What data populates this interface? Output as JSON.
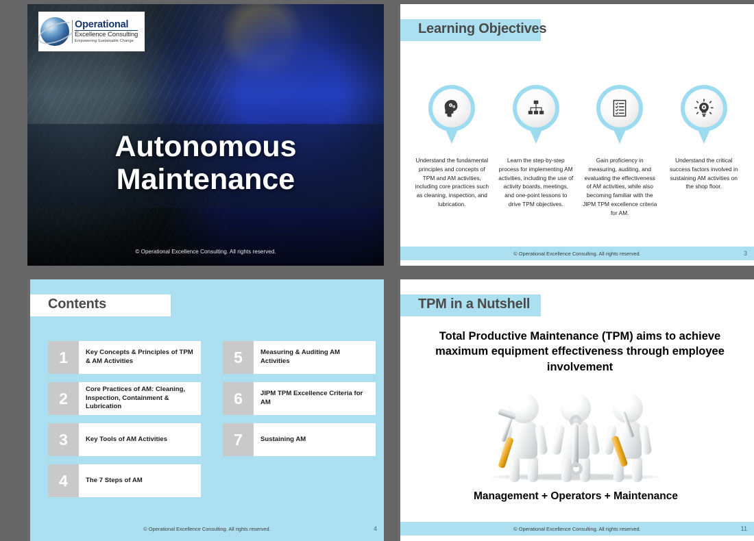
{
  "theme": {
    "accent_blue": "#ACE0F0",
    "pin_blue": "#9ddcf0",
    "gray_bg": "#666666",
    "num_box_gray": "#c9c9c9",
    "title_gray": "#4a4a4a"
  },
  "slide_title": {
    "logo": {
      "line1": "Operational",
      "line2": "Excellence Consulting",
      "line3": "Empowering Sustainable Change"
    },
    "title_line1": "Autonomous",
    "title_line2": "Maintenance",
    "copyright": "© Operational Excellence Consulting.  All rights reserved."
  },
  "slide_objectives": {
    "heading": "Learning Objectives",
    "items": [
      {
        "icon": "head-gears-icon",
        "text": "Understand the fundamental principles and concepts of TPM and AM activities, including core practices such as cleaning, inspection, and lubrication."
      },
      {
        "icon": "org-chart-icon",
        "text": "Learn the step-by-step process for implementing AM activities, including the use of activity boards, meetings, and one-point lessons to drive TPM objectives."
      },
      {
        "icon": "checklist-icon",
        "text": "Gain proficiency in measuring, auditing, and evaluating the effectiveness of AM activities, while also becoming familiar with the JIPM TPM excellence criteria for AM."
      },
      {
        "icon": "lightbulb-gear-icon",
        "text": "Understand the critical success factors involved in sustaining AM activities on the shop floor."
      }
    ],
    "footer": "© Operational Excellence Consulting.  All rights reserved.",
    "page": "3"
  },
  "slide_contents": {
    "heading": "Contents",
    "items_left": [
      {
        "num": "1",
        "label": "Key Concepts & Principles of TPM & AM Activities"
      },
      {
        "num": "2",
        "label": "Core Practices of AM: Cleaning, Inspection, Containment & Lubrication"
      },
      {
        "num": "3",
        "label": "Key Tools of AM Activities"
      },
      {
        "num": "4",
        "label": "The 7 Steps of AM"
      }
    ],
    "items_right": [
      {
        "num": "5",
        "label": "Measuring & Auditing AM Activities"
      },
      {
        "num": "6",
        "label": "JIPM TPM Excellence Criteria for AM"
      },
      {
        "num": "7",
        "label": "Sustaining AM"
      }
    ],
    "footer": "© Operational Excellence Consulting.  All rights reserved.",
    "page": "4"
  },
  "slide_nutshell": {
    "heading": "TPM in a Nutshell",
    "statement": "Total Productive Maintenance (TPM) aims to achieve maximum equipment effectiveness through employee involvement",
    "figures": [
      {
        "tool": "hammer-icon"
      },
      {
        "tool": "wrench-icon"
      },
      {
        "tool": "screwdriver-icon"
      }
    ],
    "caption": "Management + Operators + Maintenance",
    "footer": "© Operational Excellence Consulting.  All rights reserved.",
    "page": "11"
  }
}
